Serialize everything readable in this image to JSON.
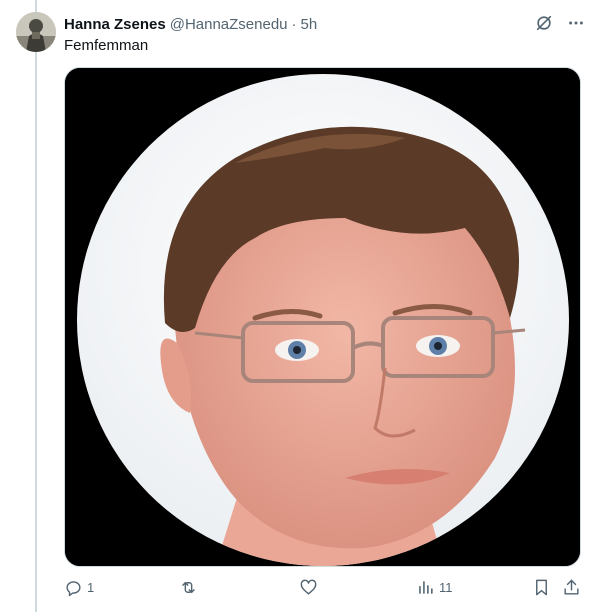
{
  "tweet": {
    "display_name": "Hanna Zsenes",
    "handle": "@HannaZsenedu",
    "separator": "·",
    "time": "5h",
    "text": "Femfemman"
  },
  "media": {
    "alt": "Circular profile photo of a young man with short brown hair wearing thin metal-rimmed glasses"
  },
  "actions": {
    "reply_count": "1",
    "retweet_count": "",
    "like_count": "",
    "views_count": "11"
  },
  "colors": {
    "text_primary": "#0f1419",
    "text_secondary": "#536471",
    "border": "#cfd9de",
    "media_background": "#000000"
  },
  "icons": [
    "grok-icon",
    "more-icon",
    "reply-icon",
    "retweet-icon",
    "like-icon",
    "views-icon",
    "bookmark-icon",
    "share-icon"
  ]
}
